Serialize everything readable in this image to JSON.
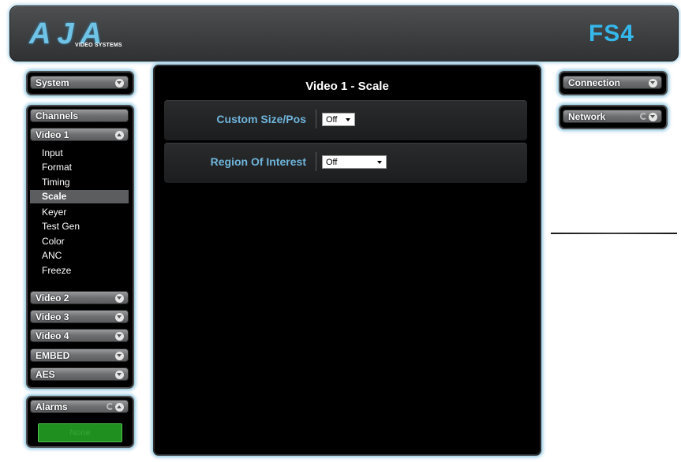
{
  "header": {
    "brand": "AJA",
    "brand_sub": "VIDEO SYSTEMS",
    "product": "FS4"
  },
  "left": {
    "system": "System",
    "channels": "Channels",
    "video1": "Video 1",
    "video1_items": [
      "Input",
      "Format",
      "Timing",
      "Scale",
      "Keyer",
      "Test Gen",
      "Color",
      "ANC",
      "Freeze"
    ],
    "active_item": "Scale",
    "video2": "Video 2",
    "video3": "Video 3",
    "video4": "Video 4",
    "embed": "EMBED",
    "aes": "AES",
    "alarms": "Alarms",
    "alarm_status": "None"
  },
  "main": {
    "title": "Video 1 - Scale",
    "rows": [
      {
        "label": "Custom Size/Pos",
        "value": "Off"
      },
      {
        "label": "Region Of Interest",
        "value": "Off"
      }
    ]
  },
  "right": {
    "connection": "Connection",
    "network": "Network"
  },
  "colors": {
    "accent": "#35b8ec",
    "label_blue": "#6fb5dc",
    "alarm_green": "#1f8f1f"
  }
}
